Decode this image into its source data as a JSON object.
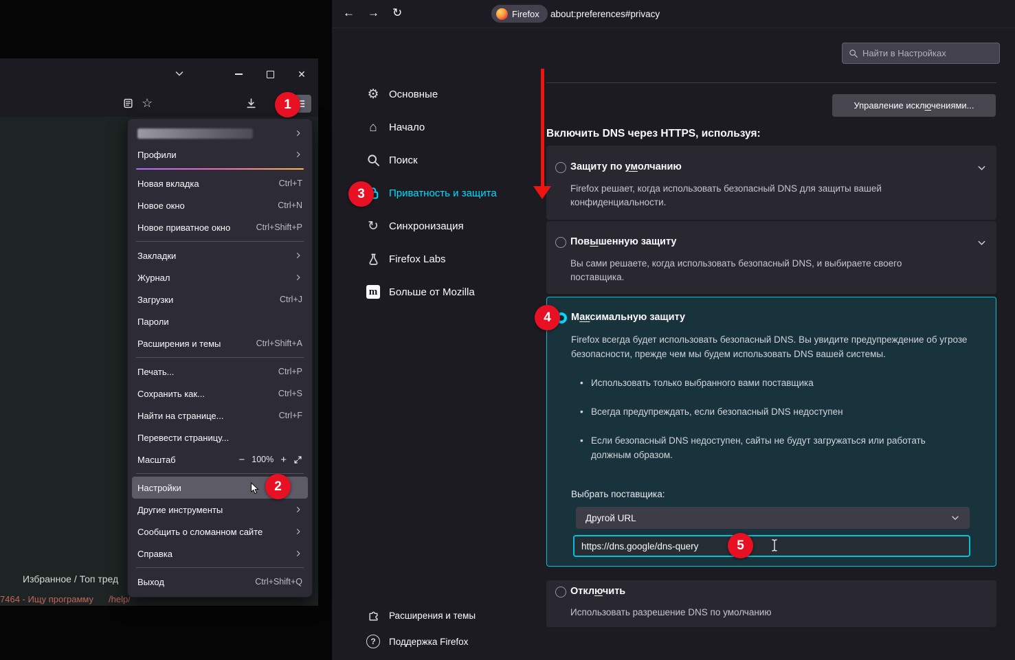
{
  "colors": {
    "accent": "#00ddff",
    "badge_red": "#e81123",
    "arrow_red": "#ee1510",
    "selected_card_border": "#00c3d9"
  },
  "badges": {
    "b1": "1",
    "b2": "2",
    "b3": "3",
    "b4": "4",
    "b5": "5"
  },
  "nav": {
    "url_pill": "Firefox",
    "url": "about:preferences#privacy"
  },
  "left_window": {
    "footer": {
      "breadcrumb": "Избранное / Топ тред",
      "thread": "7464 - Ищу программу",
      "help": "/help/"
    },
    "menu": {
      "items": [
        {
          "type": "redacted"
        },
        {
          "label": "Профили"
        },
        {},
        {
          "label": "Новая вкладка",
          "shortcut": "Ctrl+T"
        },
        {
          "label": "Новое окно",
          "shortcut": "Ctrl+N"
        },
        {
          "label": "Новое приватное окно",
          "shortcut": "Ctrl+Shift+P"
        },
        {},
        {
          "label": "Закладки"
        },
        {
          "label": "Журнал"
        },
        {
          "label": "Загрузки",
          "shortcut": "Ctrl+J"
        },
        {
          "label": "Пароли"
        },
        {
          "label": "Расширения и темы",
          "shortcut": "Ctrl+Shift+A"
        },
        {},
        {
          "label": "Печать...",
          "shortcut": "Ctrl+P"
        },
        {
          "label": "Сохранить как...",
          "shortcut": "Ctrl+S"
        },
        {
          "label": "Найти на странице...",
          "shortcut": "Ctrl+F"
        },
        {
          "label": "Перевести страницу..."
        },
        {
          "label": "Масштаб",
          "value": "100%",
          "zoom_out": "−",
          "zoom_in": "+"
        },
        {},
        {
          "label": "Настройки"
        },
        {
          "label": "Другие инструменты"
        },
        {
          "label": "Сообщить о сломанном сайте"
        },
        {
          "label": "Справка"
        },
        {},
        {
          "label": "Выход",
          "shortcut": "Ctrl+Shift+Q"
        }
      ]
    }
  },
  "settings": {
    "search_placeholder": "Найти в Настройках",
    "sidebar": [
      {
        "label": "Основные"
      },
      {
        "label": "Начало"
      },
      {
        "label": "Поиск"
      },
      {
        "label": "Приватность и защита"
      },
      {
        "label": "Синхронизация"
      },
      {
        "label": "Firefox Labs"
      },
      {
        "label": "Больше от Mozilla",
        "icon_letter": "m"
      }
    ],
    "sidebar_footer": [
      {
        "label": "Расширения и темы"
      },
      {
        "label": "Поддержка Firefox",
        "icon_letter": "?"
      }
    ],
    "manage_exceptions": {
      "pre": "Управление искл",
      "u": "ю",
      "post": "чениями..."
    },
    "dns_heading": "Включить DNS через HTTPS, используя:",
    "options": [
      {
        "title": {
          "pre": "Защиту по ",
          "u": "ум",
          "post": "олчанию"
        },
        "desc": "Firefox решает, когда использовать безопасный DNS для защиты вашей конфиденциальности."
      },
      {
        "title": {
          "pre": "Пов",
          "u": "ы",
          "post": "шенную защиту"
        },
        "desc": "Вы сами решаете, когда использовать безопасный DNS, и выбираете своего поставщика."
      },
      {
        "title": {
          "pre": "М",
          "u": "ак",
          "post": "симальную защиту"
        },
        "desc": "Firefox всегда будет использовать безопасный DNS. Вы увидите предупреждение об угрозе безопасности, прежде чем мы будем использовать DNS вашей системы.",
        "bullets": [
          "Использовать только выбранного вами поставщика",
          "Всегда предупреждать, если безопасный DNS недоступен",
          "Если безопасный DNS недоступен, сайты не будут загружаться или работать должным образом."
        ],
        "provider_label": "Выбрать поставщика:",
        "provider_value": "Другой URL",
        "url_value": "https://dns.google/dns-query"
      },
      {
        "title": {
          "pre": "Откл",
          "u": "ю",
          "post": "чить"
        },
        "desc": "Использовать разрешение DNS по умолчанию"
      }
    ]
  }
}
